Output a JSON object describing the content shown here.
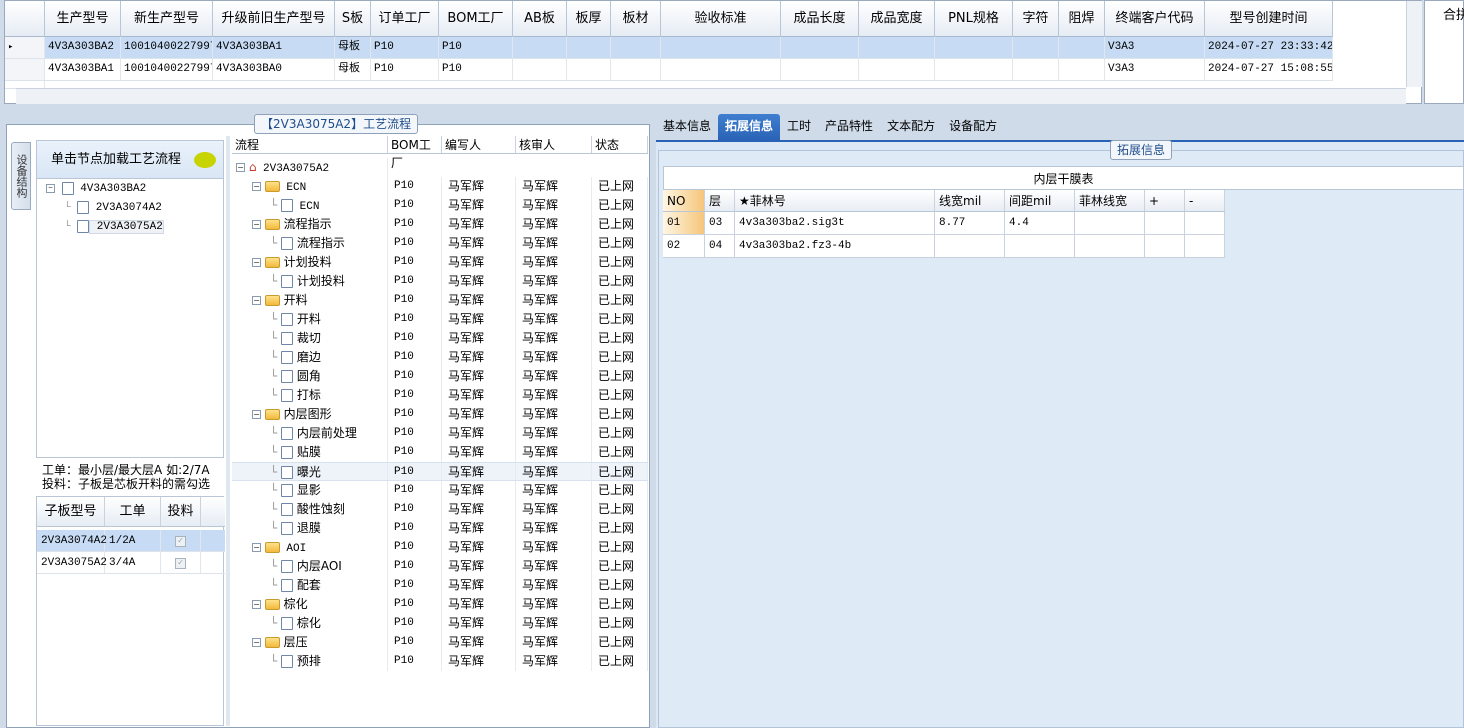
{
  "top_grid": {
    "columns": [
      "生产型号",
      "新生产型号",
      "升级前旧生产型号",
      "S板",
      "订单工厂",
      "BOM工厂",
      "AB板",
      "板厚",
      "板材",
      "验收标准",
      "成品长度",
      "成品宽度",
      "PNL规格",
      "字符",
      "阻焊",
      "终端客户代码",
      "型号创建时间"
    ],
    "rows": [
      {
        "selected": true,
        "cells": [
          "4V3A303BA2",
          "10010400227997",
          "4V3A303BA1",
          "母板",
          "P10",
          "P10",
          "",
          "",
          "",
          "",
          "",
          "",
          "",
          "",
          "",
          "V3A3",
          "2024-07-27 23:33:42"
        ]
      },
      {
        "selected": false,
        "cells": [
          "4V3A303BA1",
          "10010400227997",
          "4V3A303BA0",
          "母板",
          "P10",
          "P10",
          "",
          "",
          "",
          "",
          "",
          "",
          "",
          "",
          "",
          "V3A3",
          "2024-07-27 15:08:55"
        ]
      }
    ],
    "right_stub_label": "合拼"
  },
  "left_panel": {
    "title": "【2V3A3075A2】工艺流程",
    "vertical_tab": "设备结构",
    "tree_header": "单击节点加载工艺流程",
    "tree": [
      {
        "label": "4V3A303BA2",
        "level": 0
      },
      {
        "label": "2V3A3074A2",
        "level": 1
      },
      {
        "label": "2V3A3075A2",
        "level": 1
      }
    ],
    "notes": [
      "工单：最小层/最大层A 如:2/7A",
      "投料：子板是芯板开料的需勾选"
    ],
    "sub_grid": {
      "columns": [
        "子板型号",
        "工单",
        "投料"
      ],
      "rows": [
        {
          "selected": true,
          "cells": [
            "2V3A3074A2",
            "1/2A"
          ],
          "checked": true
        },
        {
          "selected": false,
          "cells": [
            "2V3A3075A2",
            "3/4A"
          ],
          "checked": true
        }
      ]
    }
  },
  "process_grid": {
    "columns": [
      "流程",
      "BOM工厂",
      "编写人",
      "核审人",
      "状态"
    ],
    "root": "2V3A3075A2",
    "rows": [
      {
        "type": "folder",
        "name": "ECN",
        "factory": "P10",
        "writer": "马军辉",
        "reviewer": "马军辉",
        "status": "已上网"
      },
      {
        "type": "leaf",
        "name": "ECN",
        "factory": "P10",
        "writer": "马军辉",
        "reviewer": "马军辉",
        "status": "已上网"
      },
      {
        "type": "folder",
        "name": "流程指示",
        "factory": "P10",
        "writer": "马军辉",
        "reviewer": "马军辉",
        "status": "已上网"
      },
      {
        "type": "leaf",
        "name": "流程指示",
        "factory": "P10",
        "writer": "马军辉",
        "reviewer": "马军辉",
        "status": "已上网"
      },
      {
        "type": "folder",
        "name": "计划投料",
        "factory": "P10",
        "writer": "马军辉",
        "reviewer": "马军辉",
        "status": "已上网"
      },
      {
        "type": "leaf",
        "name": "计划投料",
        "factory": "P10",
        "writer": "马军辉",
        "reviewer": "马军辉",
        "status": "已上网"
      },
      {
        "type": "folder",
        "name": "开料",
        "factory": "P10",
        "writer": "马军辉",
        "reviewer": "马军辉",
        "status": "已上网"
      },
      {
        "type": "leaf",
        "name": "开料",
        "factory": "P10",
        "writer": "马军辉",
        "reviewer": "马军辉",
        "status": "已上网"
      },
      {
        "type": "leaf",
        "name": "裁切",
        "factory": "P10",
        "writer": "马军辉",
        "reviewer": "马军辉",
        "status": "已上网"
      },
      {
        "type": "leaf",
        "name": "磨边",
        "factory": "P10",
        "writer": "马军辉",
        "reviewer": "马军辉",
        "status": "已上网"
      },
      {
        "type": "leaf",
        "name": "圆角",
        "factory": "P10",
        "writer": "马军辉",
        "reviewer": "马军辉",
        "status": "已上网"
      },
      {
        "type": "leaf",
        "name": "打标",
        "factory": "P10",
        "writer": "马军辉",
        "reviewer": "马军辉",
        "status": "已上网"
      },
      {
        "type": "folder",
        "name": "内层图形",
        "factory": "P10",
        "writer": "马军辉",
        "reviewer": "马军辉",
        "status": "已上网"
      },
      {
        "type": "leaf",
        "name": "内层前处理",
        "factory": "P10",
        "writer": "马军辉",
        "reviewer": "马军辉",
        "status": "已上网"
      },
      {
        "type": "leaf",
        "name": "贴膜",
        "factory": "P10",
        "writer": "马军辉",
        "reviewer": "马军辉",
        "status": "已上网"
      },
      {
        "type": "leaf",
        "name": "曝光",
        "factory": "P10",
        "writer": "马军辉",
        "reviewer": "马军辉",
        "status": "已上网",
        "highlight": true
      },
      {
        "type": "leaf",
        "name": "显影",
        "factory": "P10",
        "writer": "马军辉",
        "reviewer": "马军辉",
        "status": "已上网"
      },
      {
        "type": "leaf",
        "name": "酸性蚀刻",
        "factory": "P10",
        "writer": "马军辉",
        "reviewer": "马军辉",
        "status": "已上网"
      },
      {
        "type": "leaf",
        "name": "退膜",
        "factory": "P10",
        "writer": "马军辉",
        "reviewer": "马军辉",
        "status": "已上网"
      },
      {
        "type": "folder",
        "name": "AOI",
        "factory": "P10",
        "writer": "马军辉",
        "reviewer": "马军辉",
        "status": "已上网"
      },
      {
        "type": "leaf",
        "name": "内层AOI",
        "factory": "P10",
        "writer": "马军辉",
        "reviewer": "马军辉",
        "status": "已上网"
      },
      {
        "type": "leaf",
        "name": "配套",
        "factory": "P10",
        "writer": "马军辉",
        "reviewer": "马军辉",
        "status": "已上网"
      },
      {
        "type": "folder",
        "name": "棕化",
        "factory": "P10",
        "writer": "马军辉",
        "reviewer": "马军辉",
        "status": "已上网"
      },
      {
        "type": "leaf",
        "name": "棕化",
        "factory": "P10",
        "writer": "马军辉",
        "reviewer": "马军辉",
        "status": "已上网"
      },
      {
        "type": "folder",
        "name": "层压",
        "factory": "P10",
        "writer": "马军辉",
        "reviewer": "马军辉",
        "status": "已上网"
      },
      {
        "type": "leaf",
        "name": "预排",
        "factory": "P10",
        "writer": "马军辉",
        "reviewer": "马军辉",
        "status": "已上网"
      }
    ]
  },
  "right_panel": {
    "tabs": [
      "基本信息",
      "拓展信息",
      "工时",
      "产品特性",
      "文本配方",
      "设备配方"
    ],
    "active_tab": 1,
    "section_tag": "拓展信息",
    "table_title": "内层干膜表",
    "columns": [
      "NO",
      "层",
      "★菲林号",
      "线宽mil",
      "间距mil",
      "菲林线宽",
      "+",
      "-"
    ],
    "rows": [
      [
        "01",
        "03",
        "4v3a303ba2.sig3t",
        "8.77",
        "4.4",
        "",
        "",
        ""
      ],
      [
        "02",
        "04",
        "4v3a303ba2.fz3-4b",
        "",
        "",
        "",
        "",
        ""
      ]
    ]
  }
}
